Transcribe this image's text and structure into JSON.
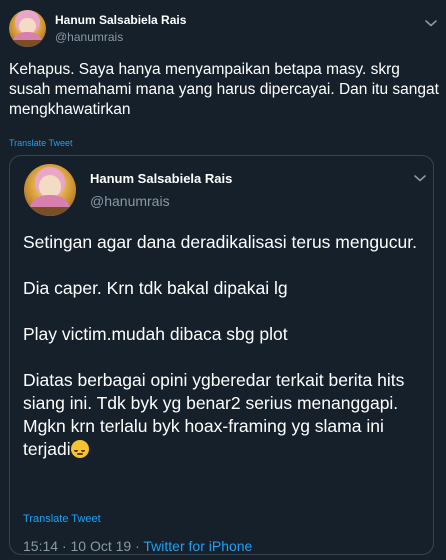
{
  "outer": {
    "name": "Hanum Salsabiela Rais",
    "handle": "@hanumrais",
    "text": "Kehapus. Saya hanya menyampaikan betapa masy. skrg susah memahami mana yang harus dipercayai. Dan itu sangat mengkhawatirkan",
    "translate": "Translate Tweet"
  },
  "quoted": {
    "name": "Hanum Salsabiela Rais",
    "handle": "@hanumrais",
    "paragraphs": [
      "Setingan agar dana deradikalisasi terus mengucur.",
      "Dia caper. Krn tdk bakal dipakai lg",
      "Play victim.mudah dibaca sbg plot",
      "Diatas berbagai opini ygberedar terkait berita hits siang ini. Tdk byk yg benar2 serius menanggapi. Mgkn krn terlalu byk hoax-framing yg slama ini terjadi"
    ],
    "emoji": "pensive-face",
    "translate": "Translate Tweet",
    "time": "15:14",
    "separator": "·",
    "date": "10 Oct 19",
    "source": "Twitter for iPhone"
  },
  "colors": {
    "background": "#15202b",
    "secondary_text": "#8899a6",
    "link": "#1da1f2",
    "border": "#38444d"
  }
}
